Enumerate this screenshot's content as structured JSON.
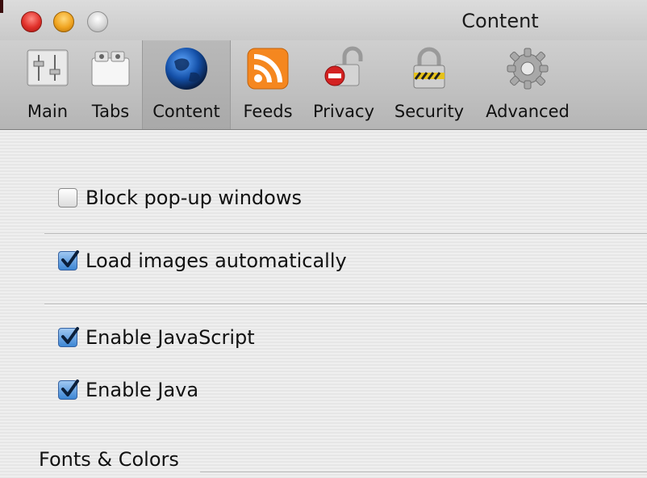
{
  "window": {
    "title": "Content"
  },
  "toolbar": {
    "items": [
      {
        "label": "Main",
        "icon": "switch-panel-icon",
        "selected": false
      },
      {
        "label": "Tabs",
        "icon": "tabs-icon",
        "selected": false
      },
      {
        "label": "Content",
        "icon": "globe-icon",
        "selected": true
      },
      {
        "label": "Feeds",
        "icon": "rss-icon",
        "selected": false
      },
      {
        "label": "Privacy",
        "icon": "open-lock-stop-icon",
        "selected": false
      },
      {
        "label": "Security",
        "icon": "padlock-icon",
        "selected": false
      },
      {
        "label": "Advanced",
        "icon": "gear-icon",
        "selected": false
      }
    ]
  },
  "options": {
    "block_popups": {
      "label": "Block pop-up windows",
      "checked": false
    },
    "load_images": {
      "label": "Load images automatically",
      "checked": true
    },
    "enable_javascript": {
      "label": "Enable JavaScript",
      "checked": true
    },
    "enable_java": {
      "label": "Enable Java",
      "checked": true
    }
  },
  "sections": {
    "fonts_colors": "Fonts & Colors"
  },
  "colors": {
    "checkbox_checked": "#3d86d4",
    "close_button": "#e0302a",
    "minimize_button": "#f0a420"
  }
}
